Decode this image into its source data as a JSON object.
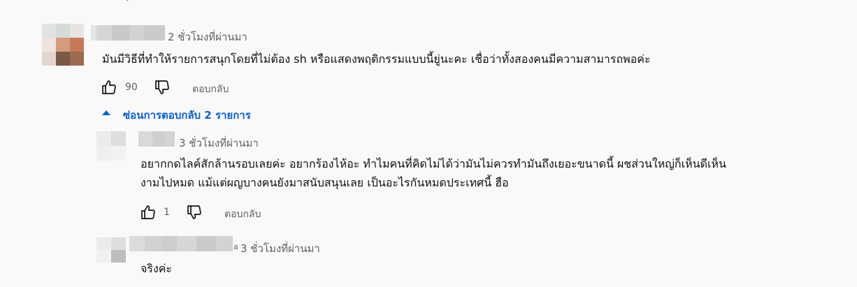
{
  "comments": [
    {
      "time": "2 ชั่วโมงที่ผ่านมา",
      "text": "มันมีวิธีที่ทำให้รายการสนุกโดยที่ไม่ต้อง sh หรือแสดงพฤติกรรมแบบนี้ยู่นะคะ เชื่อว่าทั้งสองคนมีความสามารถพอค่ะ",
      "likes": "90",
      "reply_label": "ตอบกลับ",
      "hide_replies_label": "ซ่อนการตอบกลับ 2 รายการ",
      "like_icon": "thumbs-up-icon",
      "dislike_icon": "thumbs-down-icon",
      "toggle_icon": "caret-up-icon"
    },
    {
      "time": "3 ชั่วโมงที่ผ่านมา",
      "text_line1": "อยากกดไลค์สักล้านรอบเลยค่ะ อยากร้องไห้อะ ทำไมคนที่คิดไม่ได้ว่ามันไม่ควรทำมันถึงเยอะขนาดนี้ ผชส่วนใหญ่ก็เห็นดีเห็น",
      "text_line2": "งามไปหมด แม้แต่ผญบางคนยังมาสนับสนุนเลย เป็นอะไรกันหมดประเทศนี้ ฮือ",
      "likes": "1",
      "reply_label": "ตอบกลับ",
      "like_icon": "thumbs-up-icon",
      "dislike_icon": "thumbs-down-icon"
    },
    {
      "name_suffix": "a",
      "time": "3 ชั่วโมงที่ผ่านมา",
      "text": "จริงค่ะ"
    }
  ],
  "colors": {
    "background": "#f9f9f9",
    "link_blue": "#065fd4",
    "secondary_text": "#606060",
    "primary_text": "#0f0f0f"
  }
}
